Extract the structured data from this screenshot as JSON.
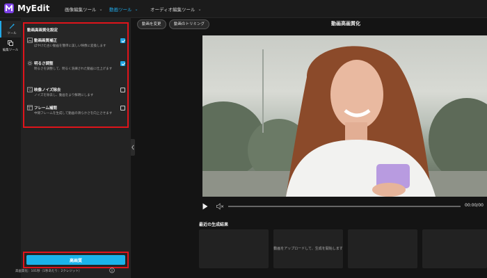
{
  "app": {
    "name": "MyEdit"
  },
  "topnav": [
    {
      "label": "画像編集ツール",
      "active": false
    },
    {
      "label": "動画ツール",
      "active": true
    },
    {
      "label": "オーディオ編集ツール",
      "active": false
    }
  ],
  "rail": [
    {
      "label": "ツール",
      "icon": "magic-wand-icon"
    },
    {
      "label": "編集ツール",
      "icon": "layers-icon"
    }
  ],
  "settings": {
    "title": "動画高画質化設定",
    "options": [
      {
        "title": "動画画質補正",
        "desc": "ぼやけた古い動画を簡単に美しい映像に変換します",
        "checked": true,
        "icon": "image-enhance-icon"
      },
      {
        "title": "明るさ調整",
        "desc": "明るさを調整して、明るく洗練された動画に仕上げます",
        "checked": true,
        "icon": "brightness-icon"
      },
      {
        "title": "映像ノイズ除去",
        "desc": "ノイズを除去し、動画をより鮮明にします",
        "checked": false,
        "icon": "denoise-icon"
      },
      {
        "title": "フレーム補間",
        "desc": "中間フレームを生成して動画の滑らかさを向上させます",
        "checked": false,
        "icon": "frame-icon"
      }
    ]
  },
  "cta": {
    "label": "高画質"
  },
  "credit": {
    "text": "高画質化：101秒（1秒あたり：2クレジット）"
  },
  "main": {
    "chips": [
      "動画を変更",
      "動画のトリミング"
    ],
    "title": "動画高画質化",
    "time": "00:00/00",
    "recent_title": "最近の生成結果",
    "upload_msg": "動画をアップロードして、生成を開始します"
  },
  "colors": {
    "accent": "#21a9e8",
    "highlight": "#e0141b",
    "cta": "#1ab3ea"
  }
}
